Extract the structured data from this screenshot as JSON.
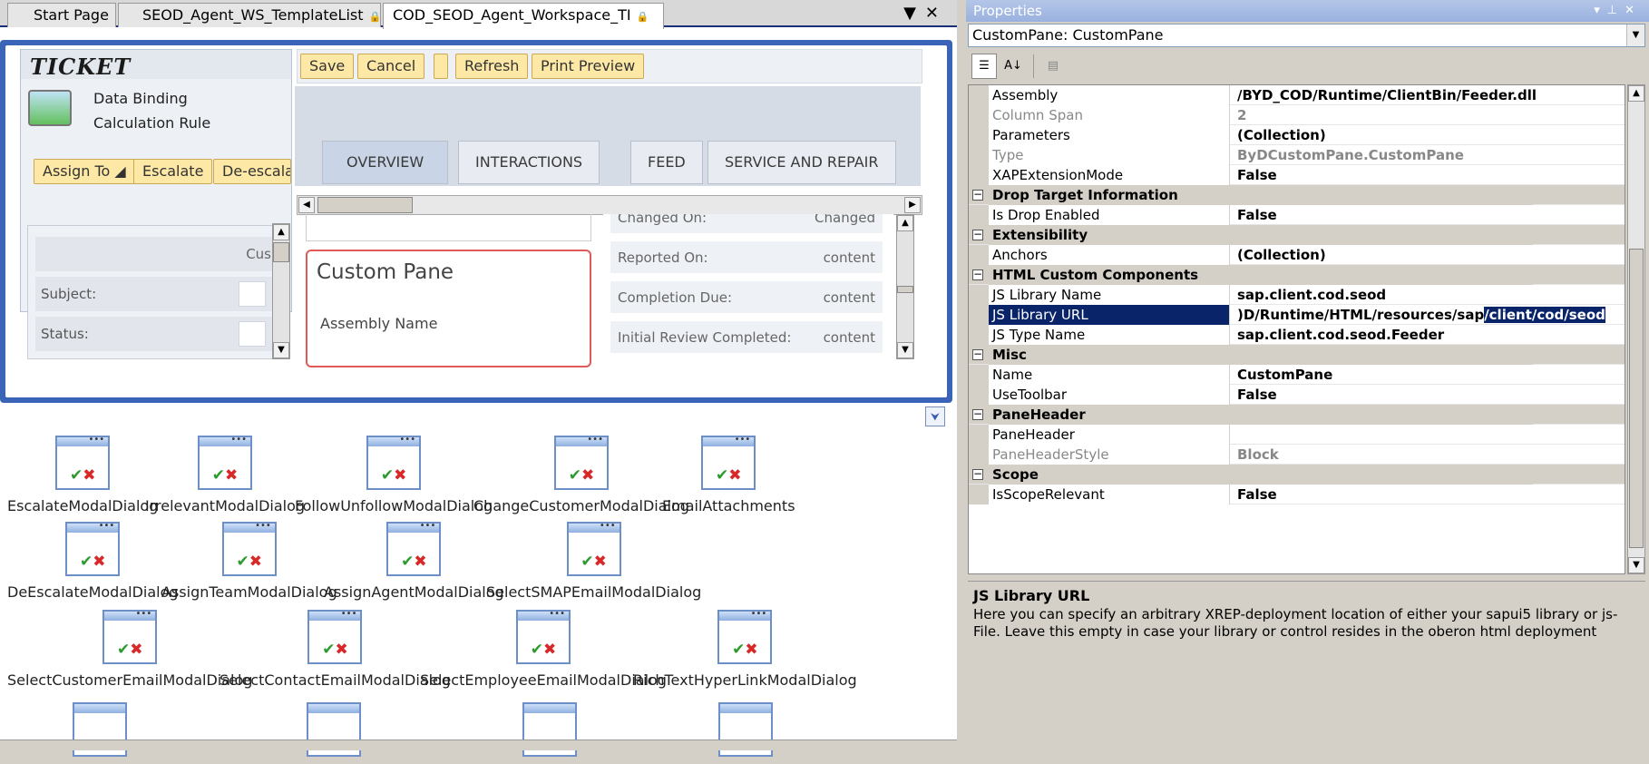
{
  "tabs": [
    {
      "label": "Start Page",
      "locked": false
    },
    {
      "label": "SEOD_Agent_WS_TemplateList",
      "locked": true
    },
    {
      "label": "COD_SEOD_Agent_Workspace_TI",
      "locked": true
    }
  ],
  "tab_controls": {
    "dropdown": "▼",
    "close": "✕"
  },
  "designer": {
    "ticket_title": "TICKET",
    "ticket_lines": [
      "Data Binding",
      "Calculation Rule"
    ],
    "ticket_buttons": [
      "Assign To ◢",
      "Escalate",
      "De-escalate"
    ],
    "toolbar_buttons": [
      "Save",
      "Cancel",
      "",
      "Refresh",
      "Print Preview"
    ],
    "tabs": [
      "OVERVIEW",
      "INTERACTIONS",
      "FEED",
      "SERVICE AND REPAIR"
    ],
    "left_fields": [
      {
        "label": "",
        "value": "Cus"
      },
      {
        "label": "Subject:"
      },
      {
        "label": "Status:"
      }
    ],
    "custom_pane": {
      "title": "Custom Pane",
      "assembly_label": "Assembly Name"
    },
    "right_fields": [
      {
        "label": "Changed On:",
        "value": "Changed"
      },
      {
        "label": "Reported On:",
        "value": "content"
      },
      {
        "label": "Completion Due:",
        "value": "content"
      },
      {
        "label": "Initial Review Completed:",
        "value": "content"
      }
    ]
  },
  "dialogs": [
    "EscalateModalDialog",
    "IrrelevantModalDialog",
    "FollowUnfollowModalDialog",
    "ChangeCustomerModalDialog",
    "EmailAttachments",
    "DeEscalateModalDialog",
    "AssignTeamModalDialog",
    "AssignAgentModalDialog",
    "SelectSMAPEmailModalDialog",
    "SelectCustomerEmailModalDialog",
    "SelectContactEmailModalDialog",
    "SelectEmployeeEmailModalDialog",
    "RichTextHyperLinkModalDialog"
  ],
  "properties": {
    "title": "Properties",
    "title_controls": "▾ ✕",
    "object": "CustomPane: CustomPane",
    "rows": [
      {
        "kind": "prop",
        "name": "Assembly",
        "value": "/BYD_COD/Runtime/ClientBin/Feeder.dll"
      },
      {
        "kind": "prop",
        "name": "Column Span",
        "value": "2",
        "dim": true
      },
      {
        "kind": "prop",
        "name": "Parameters",
        "value": "(Collection)"
      },
      {
        "kind": "prop",
        "name": "Type",
        "value": "ByDCustomPane.CustomPane",
        "dim": true
      },
      {
        "kind": "prop",
        "name": "XAPExtensionMode",
        "value": "False"
      },
      {
        "kind": "cat",
        "name": "Drop Target Information"
      },
      {
        "kind": "prop",
        "name": "Is Drop Enabled",
        "value": "False"
      },
      {
        "kind": "cat",
        "name": "Extensibility"
      },
      {
        "kind": "prop",
        "name": "Anchors",
        "value": "(Collection)"
      },
      {
        "kind": "cat",
        "name": "HTML Custom Components"
      },
      {
        "kind": "prop",
        "name": "JS Library Name",
        "value": "sap.client.cod.seod"
      },
      {
        "kind": "prop",
        "name": "JS Library URL",
        "value": ")D/Runtime/HTML/resources/sap",
        "value_selected": "/client/cod/seod",
        "selected": true
      },
      {
        "kind": "prop",
        "name": "JS Type Name",
        "value": "sap.client.cod.seod.Feeder"
      },
      {
        "kind": "cat",
        "name": "Misc"
      },
      {
        "kind": "prop",
        "name": "Name",
        "value": "CustomPane"
      },
      {
        "kind": "prop",
        "name": "UseToolbar",
        "value": "False"
      },
      {
        "kind": "cat",
        "name": "PaneHeader"
      },
      {
        "kind": "prop",
        "name": "PaneHeader",
        "value": ""
      },
      {
        "kind": "prop",
        "name": "PaneHeaderStyle",
        "value": "Block",
        "dim": true
      },
      {
        "kind": "cat",
        "name": "Scope"
      },
      {
        "kind": "prop",
        "name": "IsScopeRelevant",
        "value": "False"
      }
    ],
    "help_title": "JS Library URL",
    "help_text": "Here you can specify an arbitrary XREP-deployment location of either your sapui5 library or js-File. Leave this empty in case your library or control resides in the oberon html deployment"
  }
}
